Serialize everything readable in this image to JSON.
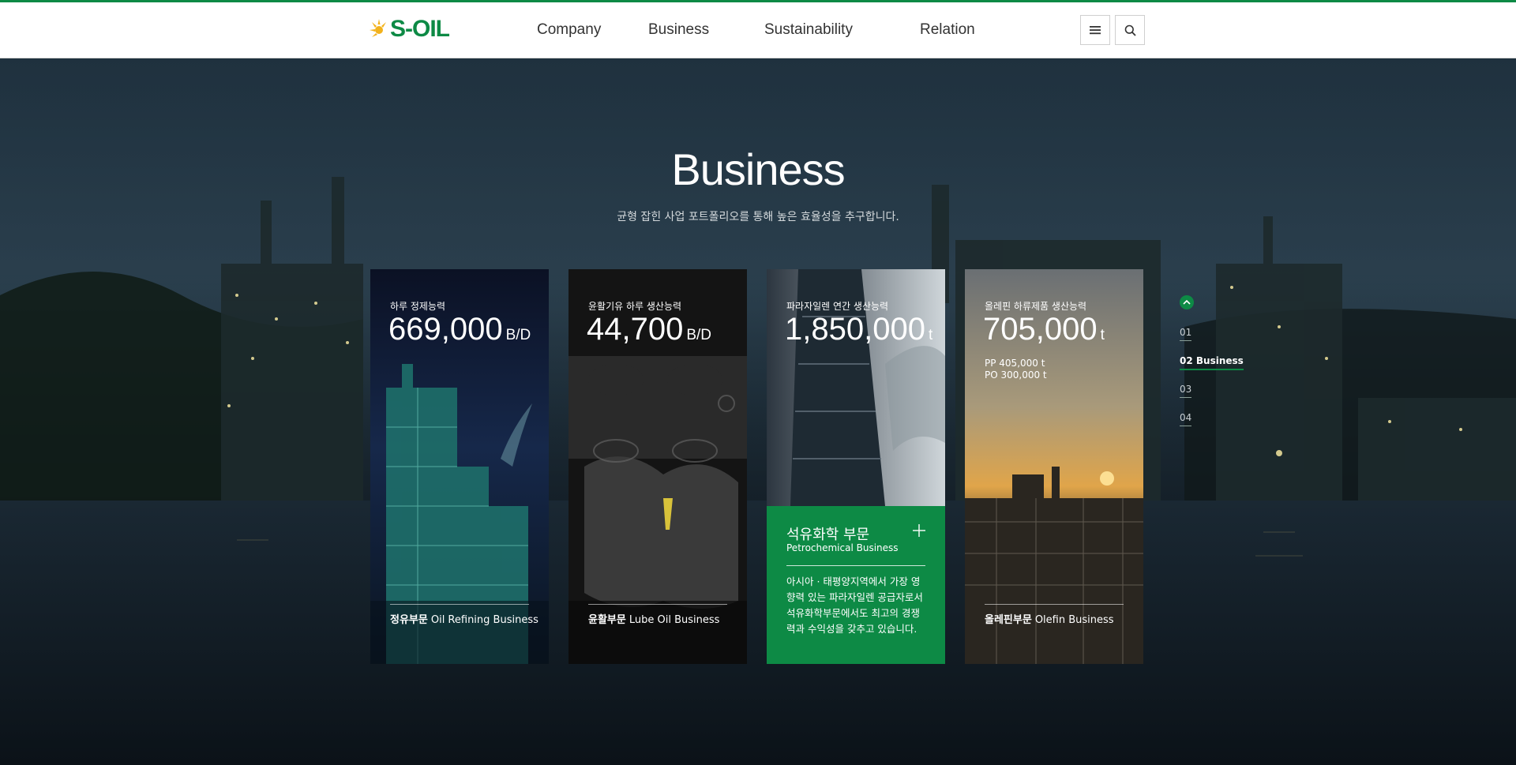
{
  "header": {
    "brand": "S-OIL",
    "nav": [
      {
        "label": "Company"
      },
      {
        "label": "Business"
      },
      {
        "label": "Sustainability"
      },
      {
        "label": "Relation"
      }
    ],
    "icons": {
      "menu": "hamburger-menu-icon",
      "search": "search-icon"
    }
  },
  "section": {
    "title": "Business",
    "subtitle": "균형 잡힌 사업 포트폴리오를 통해 높은 효율성을 추구합니다."
  },
  "cards": [
    {
      "label": "하루 정제능력",
      "value": "669,000",
      "unit": "B/D",
      "name_ko": "정유부문",
      "name_en": "Oil Refining Business"
    },
    {
      "label": "윤활기유 하루 생산능력",
      "value": "44,700",
      "unit": "B/D",
      "name_ko": "윤활부문",
      "name_en": "Lube Oil Business"
    },
    {
      "label": "파라자일렌 연간 생산능력",
      "value": "1,850,000",
      "unit": "t",
      "panel_title": "석유화학 부문",
      "panel_sub": "Petrochemical Business",
      "panel_desc": "아시아 · 태평양지역에서 가장 영향력 있는 파라자일렌 공급자로서 석유화학부문에서도 최고의 경쟁력과 수익성을 갖추고 있습니다."
    },
    {
      "label": "올레핀 하류제품 생산능력",
      "value": "705,000",
      "unit": "t",
      "note1": "PP 405,000 t",
      "note2": "PO 300,000 t",
      "name_ko": "올레핀부문",
      "name_en": "Olefin Business"
    }
  ],
  "pager": {
    "items": [
      "01",
      "02  Business",
      "03",
      "04"
    ],
    "active_index": 1
  },
  "colors": {
    "brand_green": "#0d8a45",
    "header_bg": "#ffffff"
  }
}
